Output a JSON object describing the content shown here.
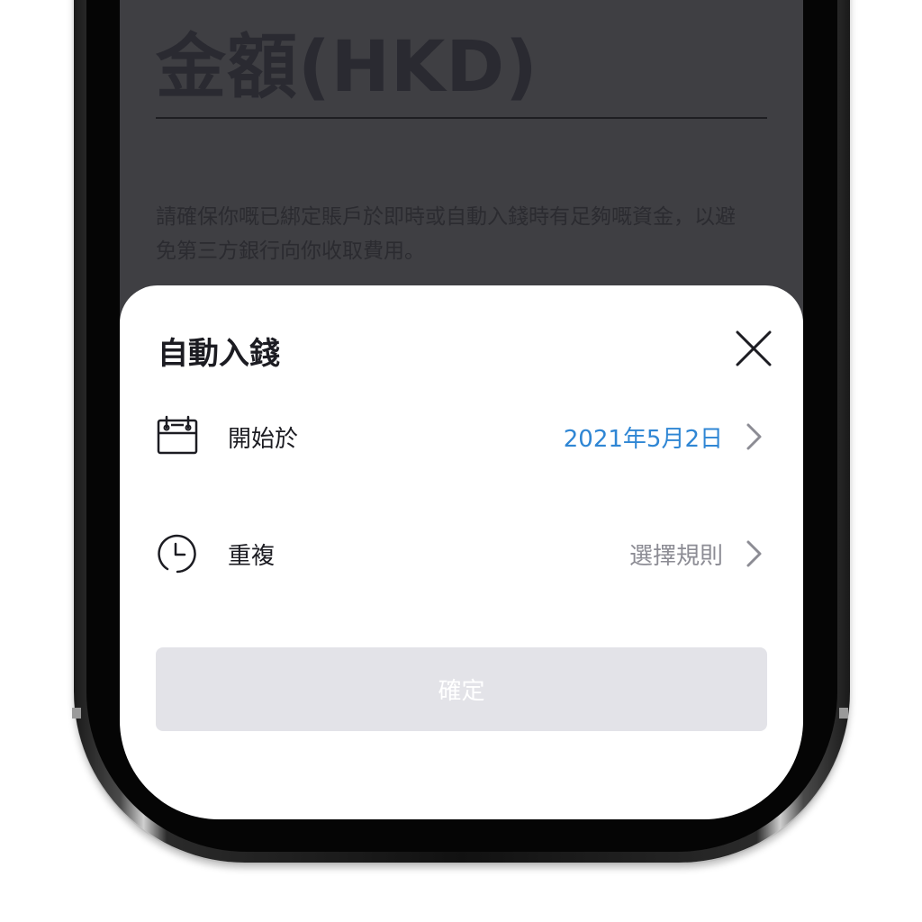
{
  "background": {
    "amount_title": "金額(HKD)",
    "note": "請確保你嘅已綁定賬戶於即時或自動入錢時有足夠嘅資金，以避免第三方銀行向你收取費用。"
  },
  "sheet": {
    "title": "自動入錢",
    "close_icon": "close-icon",
    "start_row": {
      "label": "開始於",
      "value": "2021年5月2日",
      "icon": "calendar-icon"
    },
    "repeat_row": {
      "label": "重複",
      "value": "選擇規則",
      "icon": "clock-icon"
    },
    "confirm_label": "確定"
  },
  "colors": {
    "accent_blue": "#2f86d4",
    "placeholder_gray": "#8c8c94",
    "disabled_button": "#e3e3e8",
    "overlay_dim": "#3f3f43"
  }
}
